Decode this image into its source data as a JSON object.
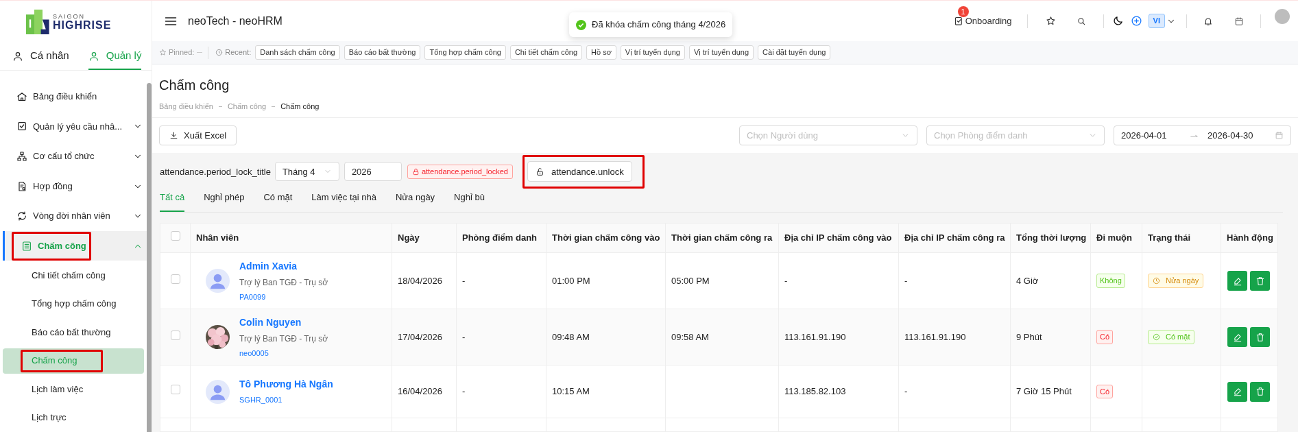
{
  "logo": {
    "line1": "SAIGON",
    "line2": "HIGHRISE"
  },
  "sidebar": {
    "tabs": [
      {
        "label": "Cá nhân",
        "selected": false
      },
      {
        "label": "Quản lý",
        "selected": true
      }
    ],
    "items": [
      {
        "label": "Bảng điều khiển",
        "selected": false,
        "highlighted": false
      },
      {
        "label": "Quản lý yêu cầu nhâ...",
        "selected": false,
        "expanded": false,
        "highlighted": false
      },
      {
        "label": "Cơ cấu tổ chức",
        "selected": false,
        "expanded": false,
        "highlighted": false
      },
      {
        "label": "Hợp đồng",
        "selected": false,
        "expanded": false,
        "highlighted": false
      },
      {
        "label": "Vòng đời nhân viên",
        "selected": false,
        "expanded": false,
        "highlighted": false
      },
      {
        "label": "Chấm công",
        "selected": true,
        "expanded": true,
        "highlighted": true,
        "children": [
          {
            "label": "Chi tiết chấm công",
            "selected": false,
            "highlighted": false
          },
          {
            "label": "Tổng hợp chấm công",
            "selected": false,
            "highlighted": false
          },
          {
            "label": "Báo cáo bất thường",
            "selected": false,
            "highlighted": false
          },
          {
            "label": "Chấm công",
            "selected": true,
            "highlighted": true
          },
          {
            "label": "Lịch làm việc",
            "selected": false,
            "highlighted": false
          },
          {
            "label": "Lịch trực",
            "selected": false,
            "highlighted": false
          }
        ]
      }
    ]
  },
  "header": {
    "title": "neoTech - neoHRM",
    "toast": "Đã khóa chấm công tháng 4/2026",
    "onboarding": {
      "label": "Onboarding",
      "badge": "1"
    },
    "language": "VI"
  },
  "recent_bar": {
    "pinned_label": "Pinned:",
    "recent_label": "Recent:",
    "chips": [
      "Danh sách chấm công",
      "Báo cáo bất thường",
      "Tổng hợp chấm công",
      "Chi tiết chấm công",
      "Hồ sơ",
      "Vị trí tuyển dụng",
      "Vị trí tuyển dụng",
      "Cài đặt tuyển dụng"
    ]
  },
  "page": {
    "title": "Chấm công",
    "breadcrumb": [
      "Bảng điều khiển",
      "Chấm công",
      "Chấm công"
    ]
  },
  "toolbar": {
    "export": "Xuất Excel",
    "user_filter": {
      "placeholder": "Chọn Người dùng"
    },
    "room_filter": {
      "placeholder": "Chọn Phòng điểm danh"
    },
    "date_from": "2026-04-01",
    "date_to": "2026-04-30"
  },
  "period_lock": {
    "title": "attendance.period_lock_title",
    "month": "Tháng 4",
    "year": "2026",
    "status": "attendance.period_locked",
    "unlock": "attendance.unlock",
    "highlighted": true
  },
  "tabs": [
    {
      "label": "Tất cả",
      "selected": true
    },
    {
      "label": "Nghỉ phép",
      "selected": false
    },
    {
      "label": "Có mặt",
      "selected": false
    },
    {
      "label": "Làm việc tại nhà",
      "selected": false
    },
    {
      "label": "Nửa ngày",
      "selected": false
    },
    {
      "label": "Nghỉ bù",
      "selected": false
    }
  ],
  "table": {
    "select_all_checked": false,
    "columns": [
      "Nhân viên",
      "Ngày",
      "Phòng điểm danh",
      "Thời gian chấm công vào",
      "Thời gian chấm công ra",
      "Địa chỉ IP chấm công vào",
      "Địa chỉ IP chấm công ra",
      "Tổng thời lượng",
      "Đi muộn",
      "Trạng thái",
      "Hành động"
    ],
    "rows": [
      {
        "checked": false,
        "avatar": {
          "kind": "icon"
        },
        "name": "Admin Xavia",
        "position": "Trợ lý Ban TGĐ - Trụ sở",
        "code": "PA0099",
        "date": "18/04/2026",
        "room": "-",
        "time_in": "01:00 PM",
        "time_out": "05:00 PM",
        "ip_in": "-",
        "ip_out": "-",
        "duration": "4 Giờ",
        "late": {
          "text": "Không",
          "kind": "no"
        },
        "status": {
          "text": "Nửa ngày",
          "kind": "half_day"
        }
      },
      {
        "checked": false,
        "name": "Colin Nguyen",
        "position": "Trợ lý Ban TGĐ - Trụ sở",
        "code": "neo0005",
        "date": "17/04/2026",
        "room": "-",
        "time_in": "09:48 AM",
        "time_out": "09:58 AM",
        "ip_in": "113.161.91.190",
        "ip_out": "113.161.91.190",
        "duration": "9 Phút",
        "late": {
          "text": "Có",
          "kind": "yes"
        },
        "status": {
          "text": "Có mặt",
          "kind": "present"
        }
      },
      {
        "checked": false,
        "avatar": {
          "kind": "icon"
        },
        "name": "Tô Phương Hà Ngân",
        "code": "SGHR_0001",
        "date": "16/04/2026",
        "room": "-",
        "time_in": "10:15 AM",
        "ip_in": "113.185.82.103",
        "ip_out": "-",
        "duration": "7 Giờ 15 Phút",
        "late": {
          "text": "Có",
          "kind": "yes"
        }
      }
    ]
  }
}
